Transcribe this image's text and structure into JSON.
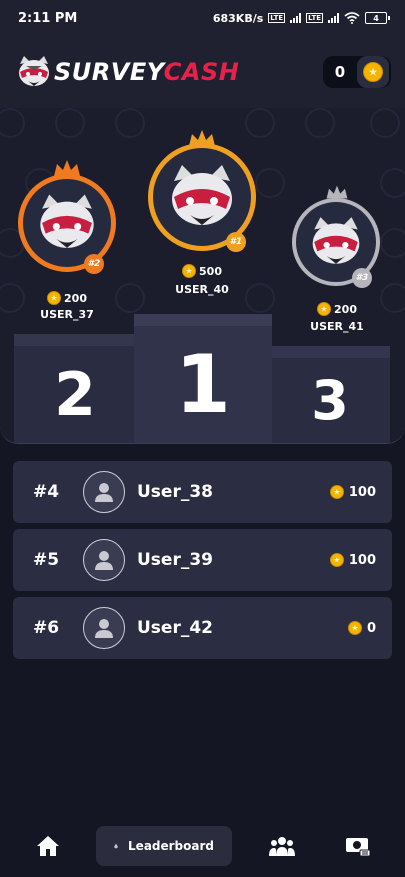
{
  "status_bar": {
    "time": "2:11 PM",
    "net_speed": "683KB/s",
    "volte": "Vo LTE",
    "battery": "4"
  },
  "header": {
    "logo_part1": "SURVEY",
    "logo_part2": "CASH",
    "coin_balance": "0",
    "icons": {
      "mascot": "raccoon-logo-icon",
      "coin": "coin-icon"
    }
  },
  "podium": {
    "first": {
      "badge": "#1",
      "points": "500",
      "username": "USER_40",
      "block_label": "1"
    },
    "second": {
      "badge": "#2",
      "points": "200",
      "username": "USER_37",
      "block_label": "2"
    },
    "third": {
      "badge": "#3",
      "points": "200",
      "username": "USER_41",
      "block_label": "3"
    }
  },
  "leaderboard": [
    {
      "rank": "#4",
      "username": "User_38",
      "points": "100"
    },
    {
      "rank": "#5",
      "username": "User_39",
      "points": "100"
    },
    {
      "rank": "#6",
      "username": "User_42",
      "points": "0"
    }
  ],
  "nav": {
    "home_icon": "home-icon",
    "leaderboard_label": "Leaderboard",
    "leaderboard_icon": "leaderboard-medal-icon",
    "community_icon": "group-icon",
    "cashout_icon": "cash-icon"
  },
  "colors": {
    "accent_red": "#e8204a",
    "gold": "#f0a020",
    "orange_ring": "#f07a20",
    "silver_ring": "#b5b5bb"
  }
}
